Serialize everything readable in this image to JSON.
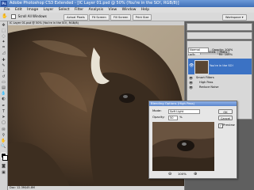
{
  "app": {
    "title": "Adobe Photoshop CS3 Extended - [IC Layer 01.psd @ 50% (You're in the SO!, RGB/8)]",
    "logo_text": "Ps",
    "workspace_label": "Workspace ▾"
  },
  "menu": [
    "File",
    "Edit",
    "Image",
    "Layer",
    "Select",
    "Filter",
    "Analysis",
    "View",
    "Window",
    "Help"
  ],
  "options_bar": {
    "checkbox_label": "Scroll All Windows",
    "buttons": [
      "Actual Pixels",
      "Fit Screen",
      "Fill Screen",
      "Print Size"
    ]
  },
  "document": {
    "title": "IC Layer 01.psd @ 50% (You're in the SO!, RGB/8)",
    "status": "Doc: 12.3M/45.8M"
  },
  "panels": {
    "top_tabs": [
      "Navigator",
      "Histogram",
      "Info"
    ],
    "mid_tabs": [
      "Color",
      "Swatches",
      "Styles"
    ],
    "layers_tabs": [
      "Layers",
      "Channels",
      "Paths"
    ],
    "blend_mode": "Normal",
    "opacity_label": "Opacity: 100%",
    "lock_label": "Lock:",
    "fill_label": "Fill: 100%",
    "layers": [
      {
        "name": "You're in the SO!",
        "selected": true
      },
      {
        "name": "Smart Filters",
        "selected": false
      },
      {
        "name": "High Pass",
        "selected": false
      },
      {
        "name": "Reduce Noise",
        "selected": false
      }
    ]
  },
  "dialog": {
    "title": "Blending Options (High Pass)",
    "mode_label": "Mode:",
    "mode_value": "Soft Light",
    "opacity_label": "Opacity:",
    "opacity_value": "50",
    "opacity_unit": "%",
    "ok_label": "OK",
    "cancel_label": "Cancel",
    "preview_label": "Preview",
    "preview_checked": true,
    "zoom_value": "100%"
  }
}
